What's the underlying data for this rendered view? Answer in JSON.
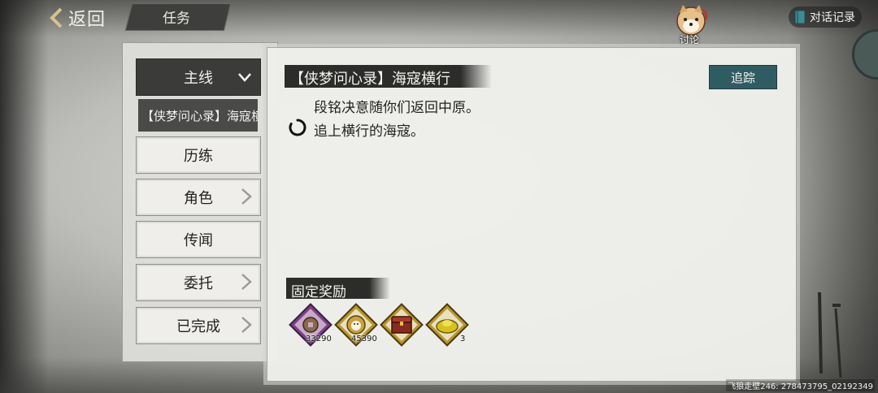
{
  "header": {
    "back_label": "返回",
    "page_title": "任务",
    "discuss_label": "讨论",
    "dialog_log_label": "对话记录"
  },
  "categories": [
    {
      "label": "主线",
      "selected": true
    },
    {
      "label": "历练"
    },
    {
      "label": "角色"
    },
    {
      "label": "传闻"
    },
    {
      "label": "委托"
    },
    {
      "label": "已完成"
    }
  ],
  "sub_quest": "【侠梦问心录】海寇横行",
  "quest": {
    "title": "【侠梦问心录】海寇横行",
    "track_label": "追踪",
    "description": "段铭决意随你们返回中原。",
    "objective": "追上横行的海寇。"
  },
  "rewards": {
    "title": "固定奖励",
    "items": [
      {
        "icon": "copper-coin-icon",
        "count": "33290",
        "color": "#7a3f86"
      },
      {
        "icon": "dog-medal-icon",
        "count": "45390",
        "color": "#b8962a"
      },
      {
        "icon": "treasure-chest-icon",
        "count": "",
        "color": "#b8962a"
      },
      {
        "icon": "gold-ingot-icon",
        "count": "3",
        "color": "#b8962a"
      }
    ]
  },
  "watermark": "飞狼走壁246: 278473795_02192349"
}
